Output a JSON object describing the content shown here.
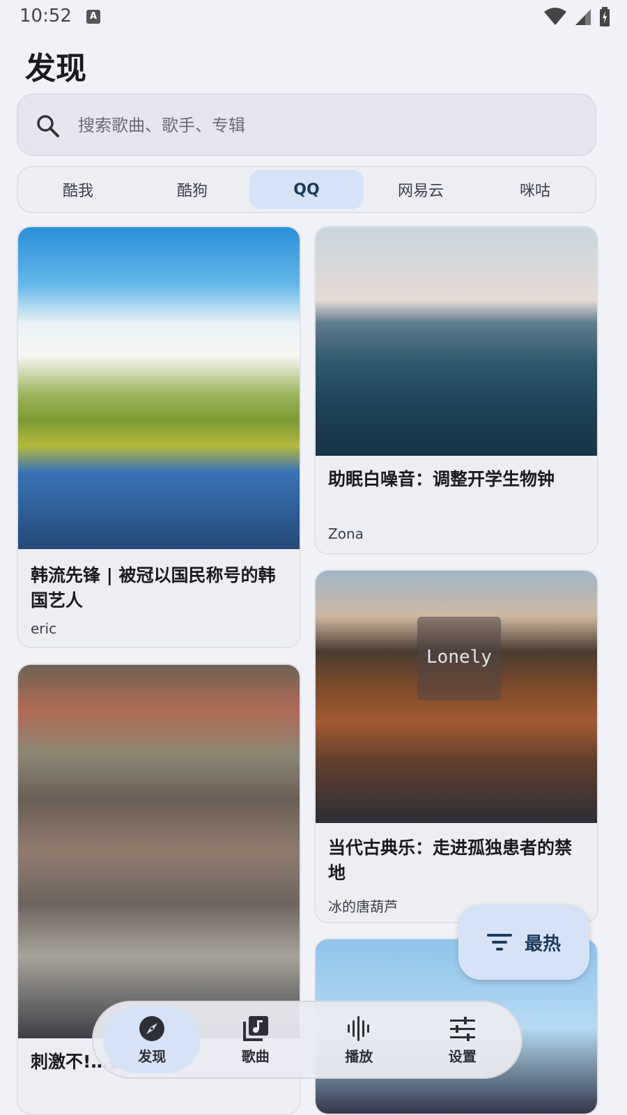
{
  "status": {
    "time": "10:52",
    "badge": "A"
  },
  "page": {
    "title": "发现"
  },
  "search": {
    "placeholder": "搜索歌曲、歌手、专辑"
  },
  "tabs": [
    {
      "label": "酷我"
    },
    {
      "label": "酷狗"
    },
    {
      "label": "QQ",
      "active": true
    },
    {
      "label": "网易云"
    },
    {
      "label": "咪咕"
    }
  ],
  "cards": [
    {
      "title": "韩流先锋 | 被冠以国民称号的韩国艺人",
      "author": "eric"
    },
    {
      "title": "助眠白噪音：调整开学生物钟",
      "author": "Zona"
    },
    {
      "title": "当代古典乐：走进孤独患者的禁地",
      "author": "冰的唐葫芦",
      "image_text": "Lonely"
    },
    {
      "title": "刺激不!…要偷偷开",
      "author": ""
    }
  ],
  "fab": {
    "label": "最热",
    "icon": "sort-icon"
  },
  "nav": [
    {
      "label": "发现",
      "icon": "compass-icon",
      "active": true
    },
    {
      "label": "歌曲",
      "icon": "music-note-icon"
    },
    {
      "label": "播放",
      "icon": "waveform-icon"
    },
    {
      "label": "设置",
      "icon": "sliders-icon"
    }
  ],
  "colors": {
    "accent": "#d6e3f7",
    "accent_text": "#1d3a5c",
    "background": "#f1f2f8"
  }
}
